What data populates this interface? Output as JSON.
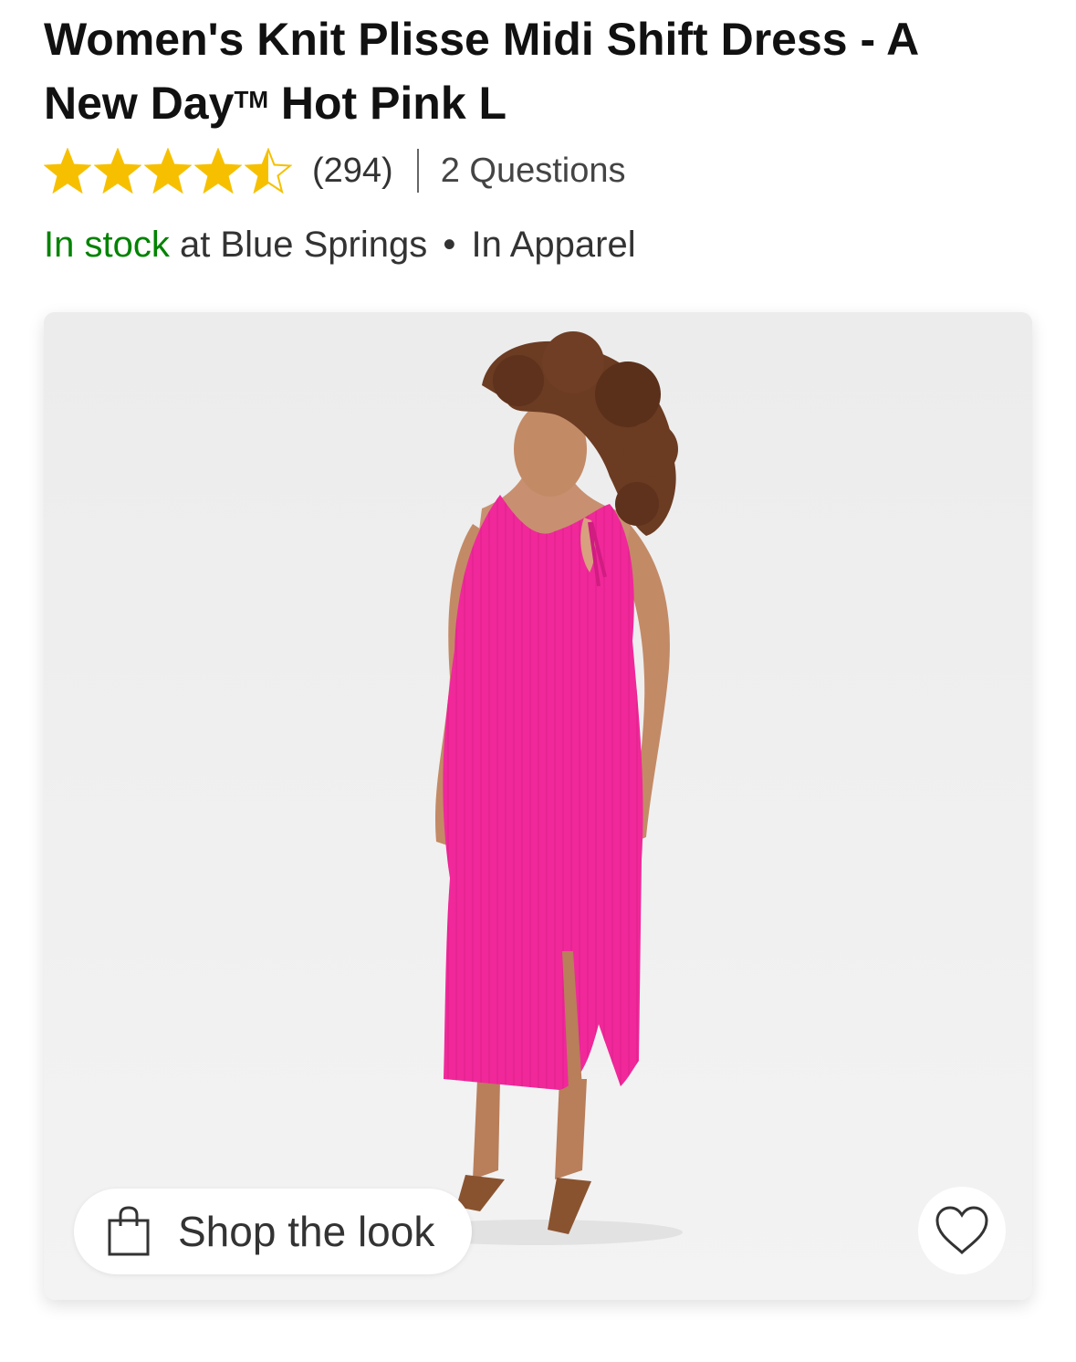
{
  "product": {
    "title_line1": "Women's Knit Plisse Midi Shift Dress - A",
    "title_line2_pre": "New Day",
    "title_tm": "TM",
    "title_line2_post": " Hot Pink L",
    "rating": 4.5,
    "rating_max": 5,
    "review_count": "(294)",
    "questions": "2 Questions"
  },
  "availability": {
    "status": "In stock",
    "store_text": " at Blue Springs ",
    "bullet": "•",
    "department": " In Apparel"
  },
  "image": {
    "shop_look_label": "Shop the look",
    "shop_icon": "shopping-bag-icon",
    "favorite_icon": "heart-outline-icon",
    "dress_color": "#f0289a"
  },
  "colors": {
    "star": "#f6c000",
    "in_stock": "#008300"
  }
}
